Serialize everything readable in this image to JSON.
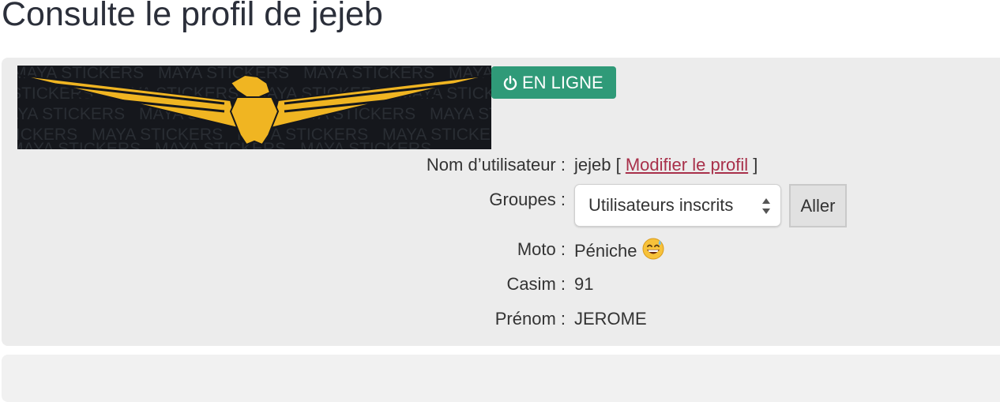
{
  "page": {
    "title": "Consulte le profil de jejeb"
  },
  "profile": {
    "banner_text": "MAYA STICKERS",
    "status_badge": "EN LIGNE",
    "status_icon": "power-icon",
    "status_color": "#2f9a78",
    "fields": {
      "username_label": "Nom d’utilisateur :",
      "username_value": "jejeb",
      "bracket_open": "[",
      "edit_profile_link": "Modifier le profil",
      "bracket_close": "]",
      "groups_label": "Groupes :",
      "groups_select_value": "Utilisateurs inscrits",
      "groups_go_button": "Aller",
      "moto_label": "Moto :",
      "moto_value": "Péniche",
      "moto_emoji": "grinning-sweat-emoji",
      "casim_label": "Casim :",
      "casim_value": "91",
      "firstname_label": "Prénom :",
      "firstname_value": "JEROME"
    },
    "link_color": "#a8304a"
  }
}
